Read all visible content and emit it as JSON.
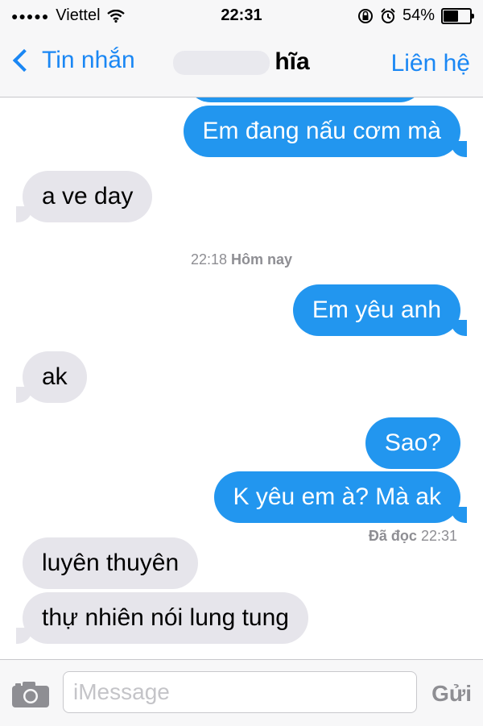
{
  "status_bar": {
    "carrier": "Viettel",
    "time": "22:31",
    "battery_percent": "54%",
    "battery_level": 0.54
  },
  "nav": {
    "back_label": "Tin nhắn",
    "contact_name_visible": "hĩa",
    "details_label": "Liên hệ"
  },
  "messages": [
    {
      "direction": "out",
      "text": "Em đang nấu cơm mà"
    },
    {
      "direction": "in",
      "text": "a ve day"
    },
    {
      "direction": "out",
      "text": "Em yêu anh"
    },
    {
      "direction": "in",
      "text": "ak"
    },
    {
      "direction": "out",
      "text": "Sao?"
    },
    {
      "direction": "out",
      "text": "K yêu em à? Mà ak"
    },
    {
      "direction": "in",
      "text": "luyên thuyên"
    },
    {
      "direction": "in",
      "text": "thự nhiên nói lung tung"
    }
  ],
  "timestamp": {
    "time": "22:18",
    "day": "Hôm nay"
  },
  "read_receipt": {
    "label": "Đã đọc",
    "time": "22:31"
  },
  "input": {
    "placeholder": "iMessage",
    "send_label": "Gửi"
  },
  "colors": {
    "accent": "#1a87f4",
    "outgoing_bubble": "#2296ef",
    "incoming_bubble": "#e6e5eb"
  },
  "icons": [
    "signal-dots-icon",
    "wifi-icon",
    "orientation-lock-icon",
    "alarm-icon",
    "battery-icon",
    "back-chevron-icon",
    "camera-icon"
  ]
}
